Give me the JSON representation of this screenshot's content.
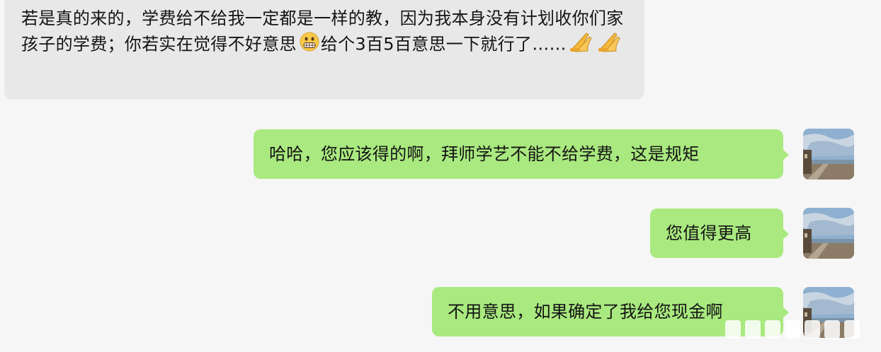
{
  "messages": {
    "incoming": {
      "text_part1": "若是真的来的，学费给不给我一定都是一样的教，因为我本身没有计划收你们家孩子的学费；你若实在觉得不好意思",
      "text_part2": "给个3百5百意思一下就行了……",
      "emojis": [
        "grimacing-emoji",
        "praying-hands-emoji",
        "praying-hands-emoji"
      ]
    },
    "outgoing": [
      {
        "text": "哈哈，您应该得的啊，拜师学艺不能不给学费，这是规矩"
      },
      {
        "text": "您值得更高"
      },
      {
        "text": "不用意思，如果确定了我给您现金啊"
      }
    ]
  },
  "colors": {
    "background": "#f6f6f6",
    "incoming_bubble": "#e8e8e8",
    "outgoing_bubble": "#a9e97f",
    "text": "#141414"
  },
  "icons": {
    "avatar": "seaside-promenade-photo-avatar"
  }
}
